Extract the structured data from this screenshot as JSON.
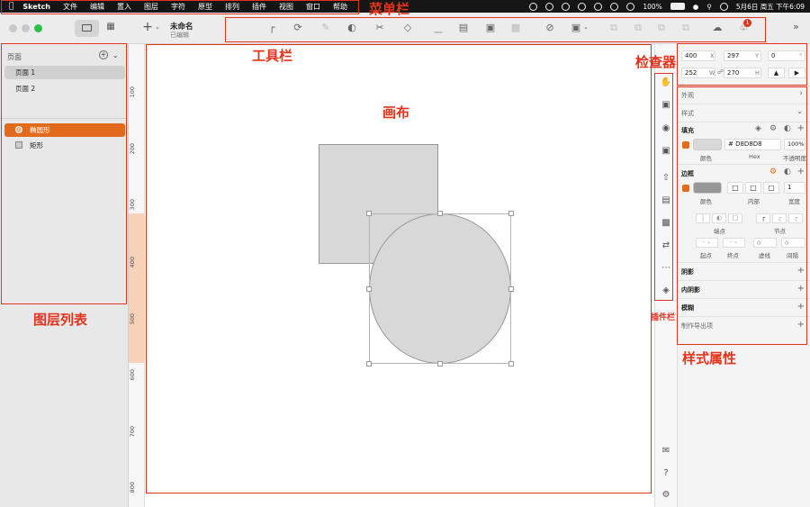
{
  "menubar": {
    "app": "Sketch",
    "items": [
      "文件",
      "编辑",
      "置入",
      "图层",
      "字符",
      "原型",
      "排列",
      "插件",
      "视图",
      "窗口",
      "帮助"
    ],
    "battery": "100%",
    "datetime": "5月6日 周五 下午6:09"
  },
  "titlebar": {
    "doc_title": "未命名",
    "doc_status": "已编辑",
    "add_symbol": "+",
    "notification_count": "1"
  },
  "sidebar": {
    "pages_header": "页面",
    "pages": [
      "页面 1",
      "页面 2"
    ],
    "layers": [
      {
        "name": "椭圆形",
        "selected": true
      },
      {
        "name": "矩形",
        "selected": false
      }
    ]
  },
  "ruler": {
    "ticks": [
      "100",
      "200",
      "300",
      "400",
      "500",
      "600",
      "700",
      "800"
    ]
  },
  "inspector": {
    "x": "400",
    "x_label": "X",
    "y": "297",
    "y_label": "Y",
    "rotation": "0",
    "rotation_label": "°",
    "w": "252",
    "w_label": "W",
    "h": "270",
    "h_label": "H",
    "appearance": "外观",
    "style": "样式",
    "fill_title": "填充",
    "fill_hex": "# D8D8D8",
    "fill_opacity": "100%",
    "fill_color_label": "颜色",
    "fill_hex_label": "Hex",
    "fill_opacity_label": "不透明度",
    "border_title": "边框",
    "border_color_label": "颜色",
    "border_pos_label": "内部",
    "border_width": "1",
    "border_width_label": "宽度",
    "endpoint_label": "端点",
    "joint_label": "节点",
    "start_label": "起点",
    "end_label": "终点",
    "dash_label": "虚线",
    "gap_label": "间隔",
    "dash_value": "0",
    "gap_value": "0",
    "shadow": "阴影",
    "inner_shadow": "内阴影",
    "blur": "模糊",
    "export": "制作导出项",
    "fill_color": "#d8d8d8",
    "border_color": "#979797"
  },
  "annotations": {
    "menubar": "菜单栏",
    "toolbar": "工具栏",
    "inspector": "检查器",
    "canvas": "画布",
    "plugins": "插件栏",
    "layers": "图层列表",
    "style": "样式属性",
    "color": "#e2341d"
  }
}
